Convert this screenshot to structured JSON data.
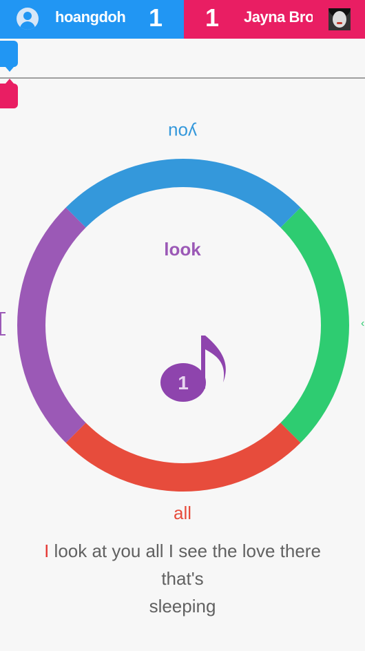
{
  "players": {
    "left": {
      "name": "hoangdoh",
      "score": "1",
      "color": "#2196f3"
    },
    "right": {
      "name": "Jayna Brown",
      "score": "1",
      "color": "#e91e63"
    }
  },
  "wheel": {
    "segments": [
      {
        "position": "top",
        "word": "you",
        "color": "#3498db"
      },
      {
        "position": "right",
        "word": "",
        "color": "#2ecc71"
      },
      {
        "position": "bottom",
        "word": "all",
        "color": "#e74c3c"
      },
      {
        "position": "left",
        "word": "",
        "color": "#9b59b6"
      }
    ],
    "center_word": "look",
    "center_word_color": "#9b59b6",
    "note_count": "1"
  },
  "lyrics": {
    "current_word": "I",
    "rest_line1": " look at you all I see the love there that's",
    "line2": "sleeping"
  }
}
